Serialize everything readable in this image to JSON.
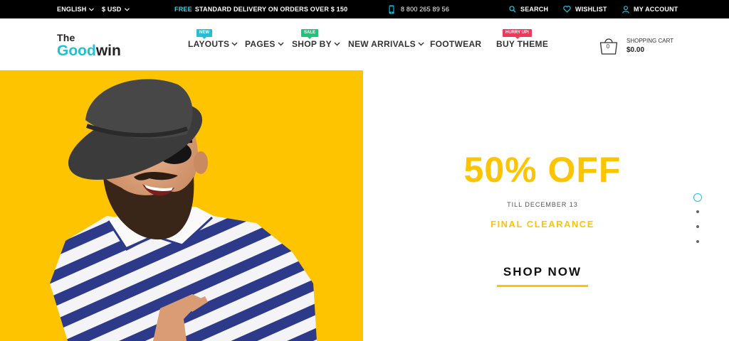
{
  "topbar": {
    "language": "ENGLISH",
    "currency": "$ USD",
    "promo_free": "FREE",
    "promo_rest": "STANDARD DELIVERY ON ORDERS OVER $ 150",
    "phone": "8 800 265 89 56",
    "search": "SEARCH",
    "wishlist": "WISHLIST",
    "account": "MY ACCOUNT"
  },
  "header": {
    "logo_the": "The",
    "logo_good": "Good",
    "logo_win": "win",
    "nav": [
      {
        "label": "LAYOUTS",
        "badge": "NEW"
      },
      {
        "label": "PAGES"
      },
      {
        "label": "SHOP BY",
        "badge": "SALE"
      },
      {
        "label": "NEW ARRIVALS"
      },
      {
        "label": "FOOTWEAR"
      },
      {
        "label": "BUY THEME",
        "badge": "HURRY UP!"
      }
    ],
    "cart_label": "SHOPPING CART",
    "cart_total": "$0.00",
    "cart_count": "0"
  },
  "hero": {
    "headline": "50% OFF",
    "date": "TILL DECEMBER 13",
    "subline": "FINAL CLEARANCE",
    "cta": "SHOP NOW",
    "slides_total": 4,
    "slide_active": 1
  },
  "colors": {
    "accent_yellow": "#ffc400",
    "accent_cyan": "#20c0d8",
    "badge_sale": "#22c27a",
    "badge_hurry": "#f0385a"
  }
}
